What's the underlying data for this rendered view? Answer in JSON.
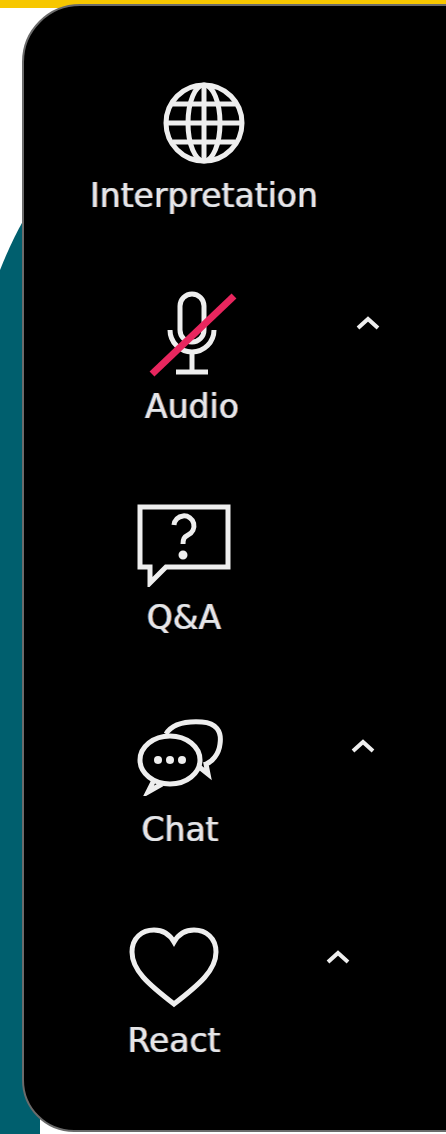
{
  "toolbar": {
    "items": [
      {
        "label": "Interpretation",
        "muted": false,
        "expandable": false
      },
      {
        "label": "Audio",
        "muted": true,
        "expandable": true
      },
      {
        "label": "Q&A",
        "muted": false,
        "expandable": false
      },
      {
        "label": "Chat",
        "muted": false,
        "expandable": true
      },
      {
        "label": "React",
        "muted": false,
        "expandable": true
      }
    ]
  }
}
